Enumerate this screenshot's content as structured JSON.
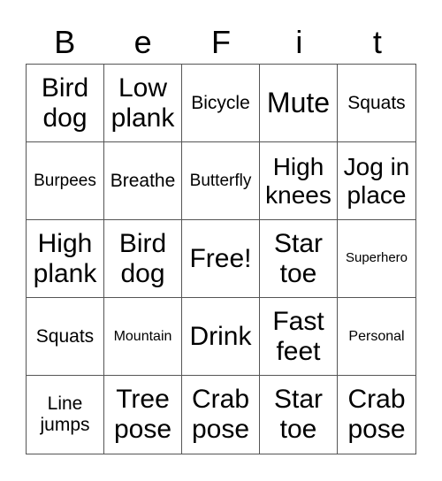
{
  "title_letters": [
    "B",
    "e",
    "F",
    "i",
    "t"
  ],
  "cells": [
    {
      "text": "Bird dog",
      "size": "s-l"
    },
    {
      "text": "Low plank",
      "size": "s-l"
    },
    {
      "text": "Bicycle",
      "size": "s-s"
    },
    {
      "text": "Mute",
      "size": "s-xl"
    },
    {
      "text": "Squats",
      "size": "s-s"
    },
    {
      "text": "Burpees",
      "size": "s-xs"
    },
    {
      "text": "Breathe",
      "size": "s-s"
    },
    {
      "text": "Butterfly",
      "size": "s-xs"
    },
    {
      "text": "High knees",
      "size": "s-m"
    },
    {
      "text": "Jog in place",
      "size": "s-m"
    },
    {
      "text": "High plank",
      "size": "s-l"
    },
    {
      "text": "Bird dog",
      "size": "s-l"
    },
    {
      "text": "Free!",
      "size": "s-l"
    },
    {
      "text": "Star toe",
      "size": "s-l"
    },
    {
      "text": "Superhero",
      "size": "s-t"
    },
    {
      "text": "Squats",
      "size": "s-s"
    },
    {
      "text": "Mountain",
      "size": "s-xxs"
    },
    {
      "text": "Drink",
      "size": "s-l"
    },
    {
      "text": "Fast feet",
      "size": "s-l"
    },
    {
      "text": "Personal",
      "size": "s-xxs"
    },
    {
      "text": "Line jumps",
      "size": "s-s"
    },
    {
      "text": "Tree pose",
      "size": "s-l"
    },
    {
      "text": "Crab pose",
      "size": "s-l"
    },
    {
      "text": "Star toe",
      "size": "s-l"
    },
    {
      "text": "Crab pose",
      "size": "s-l"
    }
  ]
}
